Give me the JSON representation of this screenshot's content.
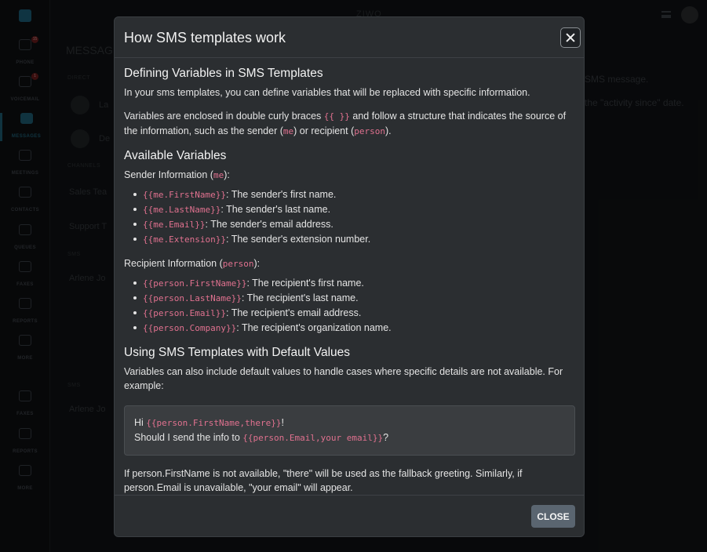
{
  "background": {
    "nav": [
      {
        "label": "PHONE",
        "icon": "phone-icon",
        "badge": "15"
      },
      {
        "label": "VOICEMAIL",
        "icon": "voicemail-icon",
        "badge": "1"
      },
      {
        "label": "MESSAGES",
        "icon": "messages-icon",
        "active": true
      },
      {
        "label": "MEETINGS",
        "icon": "meetings-icon"
      },
      {
        "label": "CONTACTS",
        "icon": "contacts-icon"
      },
      {
        "label": "QUEUES",
        "icon": "queues-icon"
      },
      {
        "label": "FAXES",
        "icon": "fax-icon"
      },
      {
        "label": "REPORTS",
        "icon": "reports-icon"
      },
      {
        "label": "MORE",
        "icon": "more-icon"
      },
      {
        "label": "FAXES",
        "icon": "fax-icon"
      },
      {
        "label": "REPORTS",
        "icon": "reports-icon"
      },
      {
        "label": "MORE",
        "icon": "more-icon"
      }
    ],
    "top_title": "ZIWO",
    "list_heading": "MESSAG",
    "sections": [
      "DIRECT",
      "CHANNELS",
      "SMS",
      "SMS"
    ],
    "rows": [
      "La",
      "De",
      "Sales Tea",
      "Support T",
      "Arlene Jo",
      "Arlene Jo"
    ],
    "right_text_1": "SMS message.",
    "right_text_2": "the \"activity since\" date."
  },
  "modal": {
    "title": "How SMS templates work",
    "section1": {
      "heading": "Defining Variables in SMS Templates",
      "para1": "In your sms templates, you can define variables that will be replaced with specific information.",
      "para2_a": "Variables are enclosed in double curly braces ",
      "para2_code1": "{{ }}",
      "para2_b": " and follow a structure that indicates the source of the information, such as the sender (",
      "para2_code2": "me",
      "para2_c": ") or recipient (",
      "para2_code3": "person",
      "para2_d": ")."
    },
    "section2": {
      "heading": "Available Variables",
      "sender_label_a": "Sender Information (",
      "sender_label_code": "me",
      "sender_label_b": "):",
      "sender_items": [
        {
          "code": "{{me.FirstName}}",
          "desc": ": The sender's first name."
        },
        {
          "code": "{{me.LastName}}",
          "desc": ": The sender's last name."
        },
        {
          "code": "{{me.Email}}",
          "desc": ": The sender's email address."
        },
        {
          "code": "{{me.Extension}}",
          "desc": ": The sender's extension number."
        }
      ],
      "recipient_label_a": "Recipient Information (",
      "recipient_label_code": "person",
      "recipient_label_b": "):",
      "recipient_items": [
        {
          "code": "{{person.FirstName}}",
          "desc": ": The recipient's first name."
        },
        {
          "code": "{{person.LastName}}",
          "desc": ": The recipient's last name."
        },
        {
          "code": "{{person.Email}}",
          "desc": ": The recipient's email address."
        },
        {
          "code": "{{person.Company}}",
          "desc": ": The recipient's organization name."
        }
      ]
    },
    "section3": {
      "heading": "Using SMS Templates with Default Values",
      "para": "Variables can also include default values to handle cases where specific details are not available. For example:",
      "example_line1_a": "Hi ",
      "example_line1_code": "{{person.FirstName,there}}",
      "example_line1_b": "!",
      "example_line2_a": "Should I send the info to ",
      "example_line2_code": "{{person.Email,your email}}",
      "example_line2_b": "?",
      "footer_para": "If person.FirstName is not available, \"there\" will be used as the fallback greeting. Similarly, if person.Email is unavailable, \"your email\" will appear."
    },
    "close_button": "CLOSE"
  },
  "colors": {
    "code_pink": "#e0718f",
    "modal_bg": "#2b2e31",
    "close_button_bg": "#5a6570",
    "accent": "#1e5d74"
  }
}
